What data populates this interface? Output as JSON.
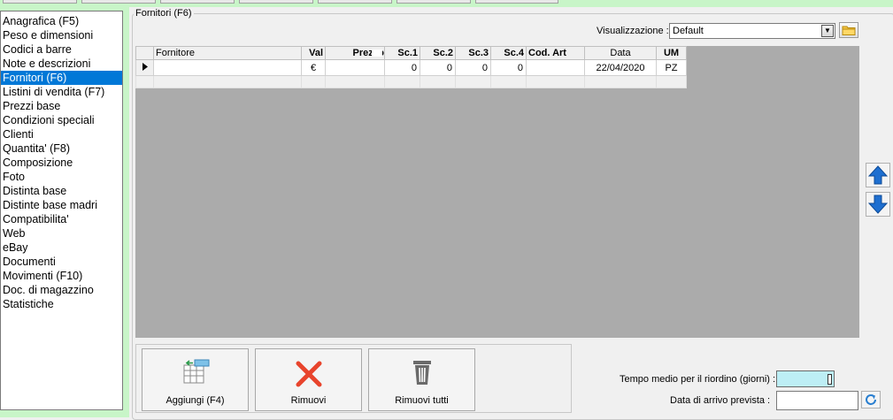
{
  "sidebar": {
    "items": [
      {
        "label": "Anagrafica (F5)"
      },
      {
        "label": "Peso e dimensioni"
      },
      {
        "label": "Codici a barre"
      },
      {
        "label": "Note e descrizioni"
      },
      {
        "label": "Fornitori (F6)",
        "selected": true
      },
      {
        "label": "Listini di vendita (F7)"
      },
      {
        "label": "Prezzi base"
      },
      {
        "label": "Condizioni speciali"
      },
      {
        "label": "Clienti"
      },
      {
        "label": "Quantita' (F8)"
      },
      {
        "label": "Composizione"
      },
      {
        "label": "Foto"
      },
      {
        "label": "Distinta base"
      },
      {
        "label": "Distinte base madri"
      },
      {
        "label": "Compatibilita'"
      },
      {
        "label": "Web"
      },
      {
        "label": "eBay"
      },
      {
        "label": "Documenti"
      },
      {
        "label": "Movimenti (F10)"
      },
      {
        "label": "Doc. di magazzino"
      },
      {
        "label": "Statistiche"
      }
    ]
  },
  "group": {
    "title": "Fornitori (F6)"
  },
  "view": {
    "label": "Visualizzazione :",
    "value": "Default"
  },
  "grid": {
    "columns": [
      "Fornitore",
      "Val",
      "Prezzo",
      "Sc.1",
      "Sc.2",
      "Sc.3",
      "Sc.4",
      "Cod. Art",
      "Data",
      "UM"
    ],
    "row": {
      "fornitore": "",
      "val": "€",
      "prezzo": "",
      "sc1": "0",
      "sc2": "0",
      "sc3": "0",
      "sc4": "0",
      "cod_art": "",
      "data": "22/04/2020",
      "um": "PZ"
    }
  },
  "buttons": {
    "add": "Aggiungi (F4)",
    "remove": "Rimuovi",
    "remove_all": "Rimuovi tutti"
  },
  "fields": {
    "tempo_label": "Tempo medio per il riordino (giorni) :",
    "tempo_value": "",
    "data_arrivo_label": "Data di arrivo prevista :",
    "data_arrivo_value": ""
  },
  "colors": {
    "accent": "#0078d7",
    "frame": "#c8f5c8",
    "remove_red": "#e8442c",
    "arrow_blue": "#1e6fd0"
  },
  "icons": [
    "dropdown-arrow-icon",
    "folder-icon",
    "move-up-icon",
    "move-down-icon",
    "add-row-icon",
    "remove-x-icon",
    "trash-icon",
    "refresh-icon",
    "row-pointer-icon"
  ]
}
